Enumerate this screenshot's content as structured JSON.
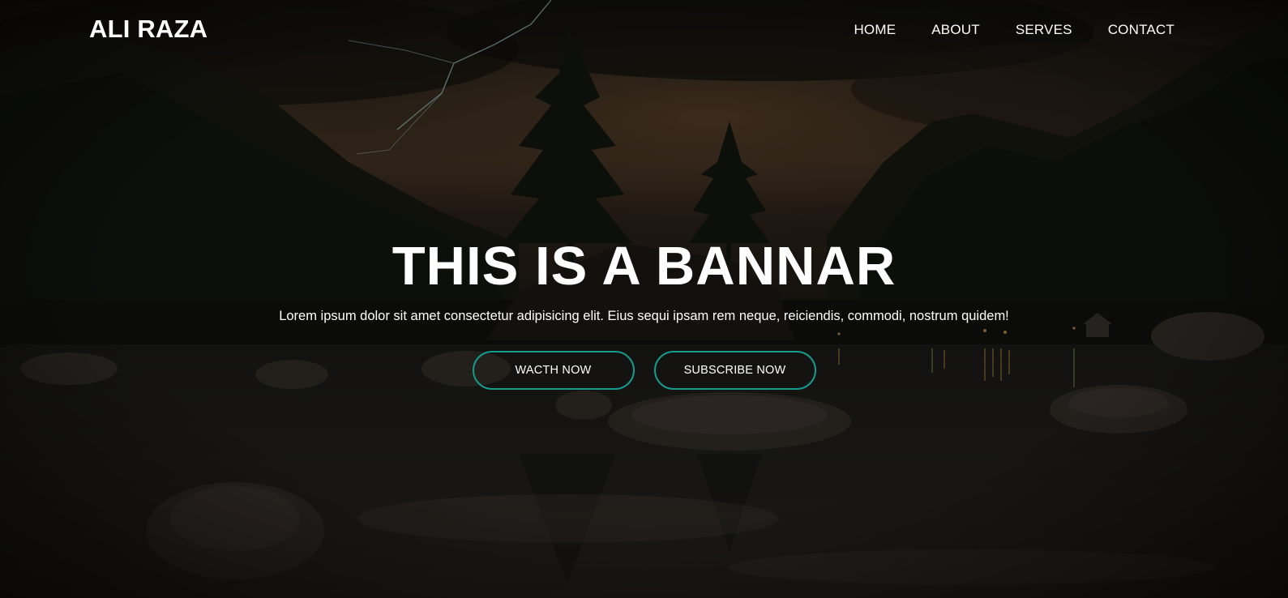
{
  "header": {
    "logo": "ALI RAZA",
    "nav": [
      {
        "label": "HOME"
      },
      {
        "label": "ABOUT"
      },
      {
        "label": "SERVES"
      },
      {
        "label": "CONTACT"
      }
    ]
  },
  "banner": {
    "title": "THIS IS A BANNAR",
    "text": "Lorem ipsum dolor sit amet consectetur adipisicing elit. Eius sequi ipsam rem neque, reiciendis, commodi, nostrum quidem!",
    "buttons": [
      {
        "label": "WACTH NOW"
      },
      {
        "label": "SUBSCRIBE NOW"
      }
    ]
  },
  "colors": {
    "button_border": "#159a8c",
    "text": "#ffffff",
    "background": "#0d0c0b"
  }
}
